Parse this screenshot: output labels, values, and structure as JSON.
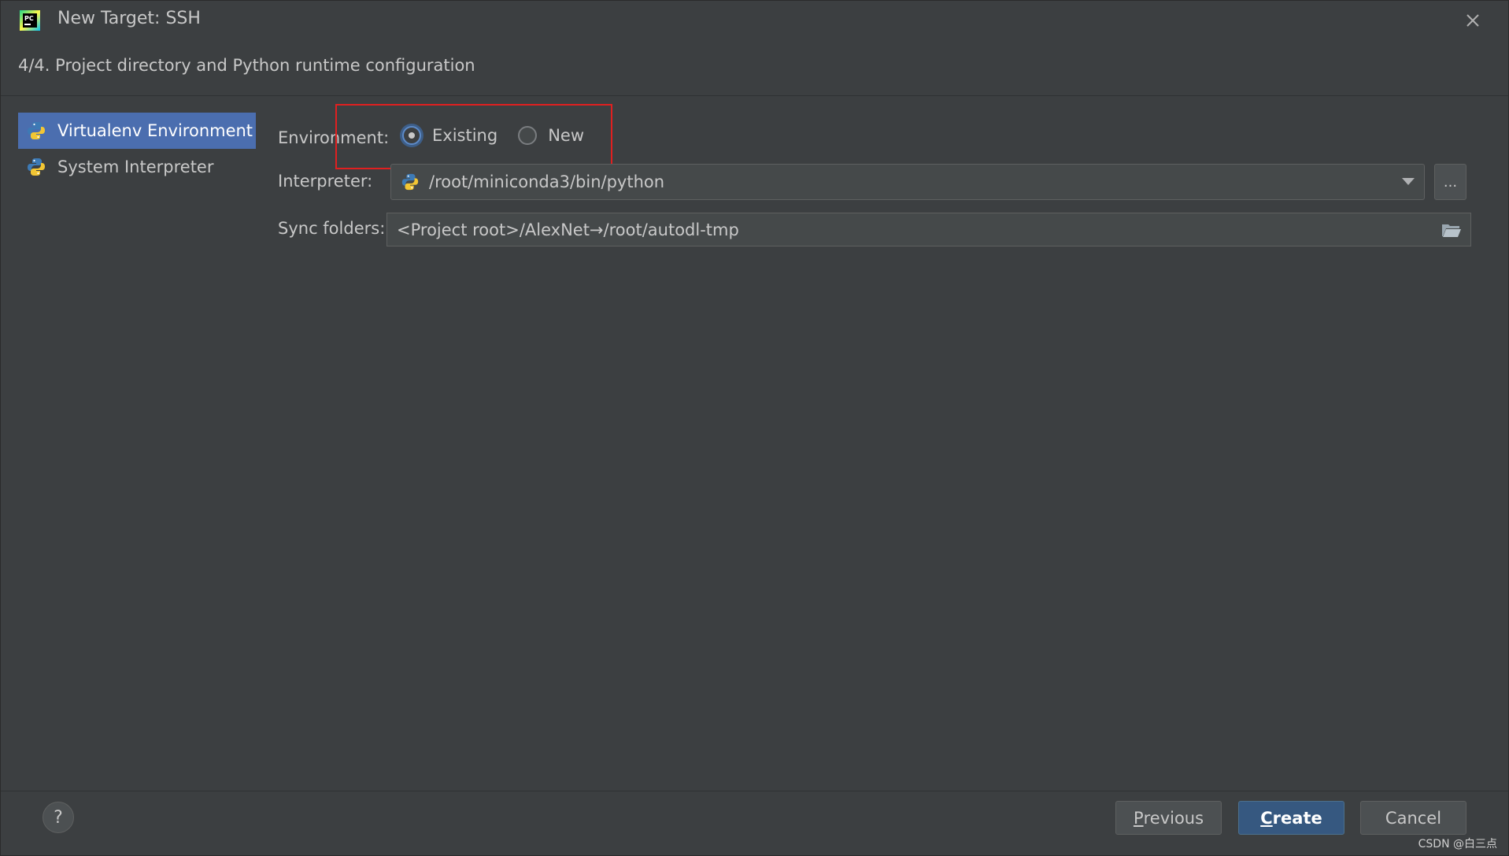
{
  "window": {
    "title": "New Target: SSH",
    "icon": "pycharm-icon"
  },
  "step": {
    "title": "4/4. Project directory and Python runtime configuration"
  },
  "sidebar": {
    "items": [
      {
        "label": "Virtualenv Environment",
        "icon": "python-icon",
        "selected": true
      },
      {
        "label": "System Interpreter",
        "icon": "python-icon",
        "selected": false
      }
    ]
  },
  "form": {
    "environment_label": "Environment:",
    "environment_options": [
      {
        "label": "Existing",
        "checked": true
      },
      {
        "label": "New",
        "checked": false
      }
    ],
    "interpreter_label": "Interpreter:",
    "interpreter_value": "/root/miniconda3/bin/python",
    "browse_label": "...",
    "sync_label": "Sync folders:",
    "sync_value": "<Project root>/AlexNet→/root/autodl-tmp"
  },
  "footer": {
    "help_label": "?",
    "previous_mnemonic": "P",
    "previous_rest": "revious",
    "create_mnemonic": "C",
    "create_rest": "reate",
    "cancel_label": "Cancel"
  },
  "watermark": "CSDN @白三点",
  "colors": {
    "background": "#3c3f41",
    "selection": "#4b6eaf",
    "primary_button": "#365880",
    "highlight_box": "#e02020"
  }
}
